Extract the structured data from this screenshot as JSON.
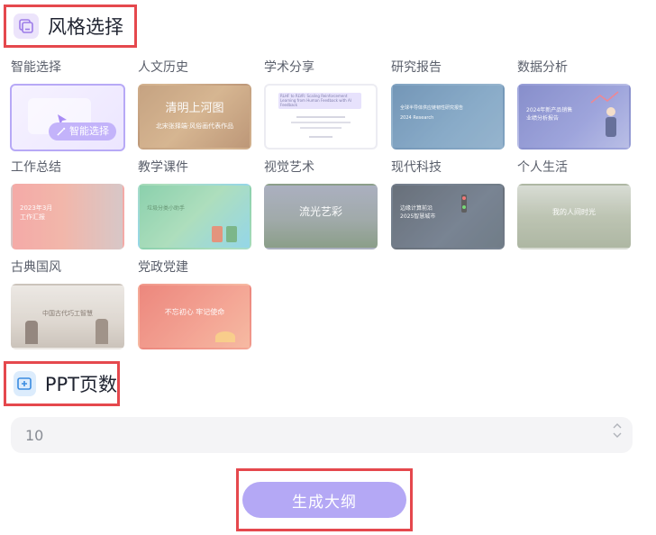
{
  "style_section": {
    "title": "风格选择",
    "icon": "style-icon"
  },
  "templates": [
    {
      "label": "智能选择",
      "selected": true,
      "badge": "智能选择",
      "badge_icon": "magic-wand-icon"
    },
    {
      "label": "人文历史",
      "thumb_title": "清明上河图",
      "thumb_sub": "北宋张择端·风俗画代表作品"
    },
    {
      "label": "学术分享",
      "thumb_title": "RLHF to RLVR: Scaling Reinforcement Learning from Human Feedback with AI Feedback"
    },
    {
      "label": "研究报告",
      "thumb_title": "全球半导体供应链韧性研究报告",
      "thumb_sub": "2024 Research"
    },
    {
      "label": "数据分析",
      "thumb_title": "2024年新产品销售",
      "thumb_sub": "业绩分析报告"
    },
    {
      "label": "工作总结",
      "thumb_title": "2023年3月",
      "thumb_sub": "工作汇报"
    },
    {
      "label": "教学课件",
      "thumb_title": "垃圾分类小助手"
    },
    {
      "label": "视觉艺术",
      "thumb_title": "流光艺彩"
    },
    {
      "label": "现代科技",
      "thumb_title": "边缘计算前沿",
      "thumb_sub": "2025智慧城市"
    },
    {
      "label": "个人生活",
      "thumb_title": "我的人间时光"
    },
    {
      "label": "古典国风",
      "thumb_title": "中国古代巧工智慧"
    },
    {
      "label": "党政党建",
      "thumb_title": "不忘初心 牢记使命"
    }
  ],
  "pages_section": {
    "title": "PPT页数",
    "icon": "page-add-icon"
  },
  "page_count": {
    "value": "10"
  },
  "generate_button": {
    "label": "生成大纲"
  },
  "colors": {
    "accent": "#b4a8f5",
    "highlight_border": "#e5484d"
  }
}
